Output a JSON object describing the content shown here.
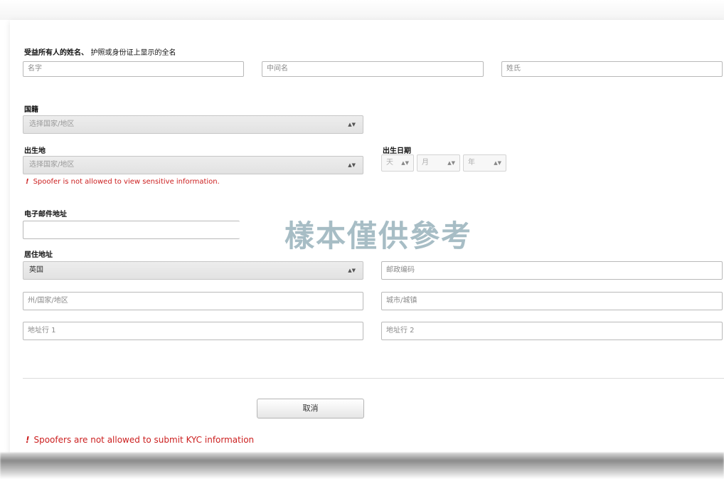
{
  "form": {
    "name_label": "受益所有人的姓名、",
    "name_hint": "护照或身份证上显示的全名",
    "first_name_placeholder": "名字",
    "middle_name_placeholder": "中间名",
    "last_name_placeholder": "姓氏",
    "nationality_label": "国籍",
    "nationality_value": "选择国家/地区",
    "birthplace_label": "出生地",
    "birthplace_value": "选择国家/地区",
    "dob_label": "出生日期",
    "dob_day": "天",
    "dob_month": "月",
    "dob_year": "年",
    "sensitive_error": "Spoofer is not allowed to view sensitive information.",
    "email_label": "电子邮件地址",
    "email_value": "",
    "residence_label": "居住地址",
    "country_value": "英国",
    "postcode_placeholder": "邮政编码",
    "state_placeholder": "州/国家/地区",
    "city_placeholder": "城市/城镇",
    "address1_placeholder": "地址行 1",
    "address2_placeholder": "地址行 2",
    "cancel_label": "取消",
    "submit_error": "Spoofers are not allowed to submit KYC information",
    "error_mark": "!",
    "dropdown_arrow": "▲▼"
  },
  "watermark": "樣本僅供參考",
  "colors": {
    "error": "#cc2020",
    "watermark": "#5f8796",
    "select_bg": "#e6e6e6"
  }
}
